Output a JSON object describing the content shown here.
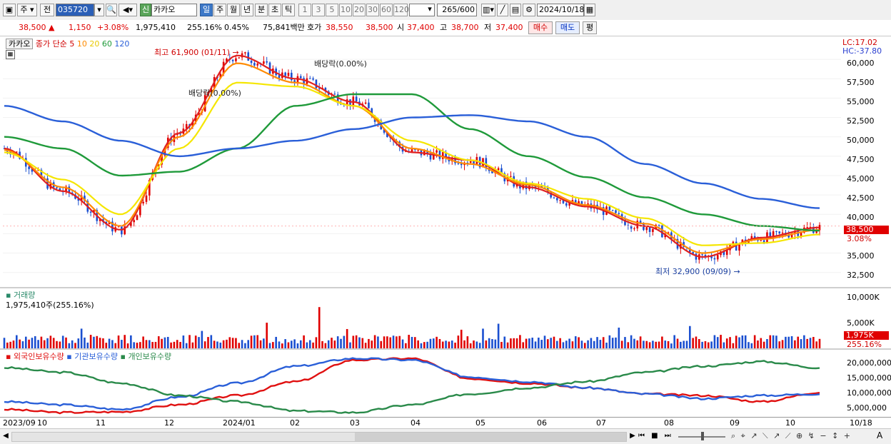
{
  "toolbar": {
    "period_label": "주",
    "prev_label": "전",
    "code": "035720",
    "market_badge": "신",
    "stock_name": "카카오",
    "interval_buttons": [
      "일",
      "주",
      "월",
      "년",
      "분",
      "초",
      "틱"
    ],
    "minute_buttons": [
      "1",
      "3",
      "5",
      "10",
      "20",
      "30",
      "60",
      "120"
    ],
    "count_value": "265",
    "count_total": "/600",
    "date_value": "2024/10/18"
  },
  "quote": {
    "price": "38,500",
    "arrow": "▲",
    "change": "1,150",
    "change_pct": "+3.08%",
    "volume": "1,975,410",
    "volume_pct": "255.16%",
    "turnover_pct": "0.45%",
    "amount": "75,841백만",
    "ask_label": "호가",
    "ask1": "38,550",
    "ask2": "38,500",
    "open_label": "시",
    "open": "37,400",
    "high_label": "고",
    "high": "38,700",
    "low_label": "저",
    "low": "37,400",
    "buy_label": "매수",
    "sell_label": "매도",
    "eval_label": "평"
  },
  "price_panel": {
    "stock_tab": "카카오",
    "legend_main": "종가 단순",
    "ma_5": "5",
    "ma_10": "10",
    "ma_20": "20",
    "ma_60": "60",
    "ma_120": "120",
    "lc": "LC:17.02",
    "hc": "HC:-37.80",
    "high_note": "최고 61,900 (01/11)",
    "low_note": "최저 32,900 (09/09)",
    "dividend_1": "배당락(0.00%)",
    "dividend_2": "배당락(0.00%)",
    "current_tag": "38,500",
    "current_pct": "3.08%",
    "y_ticks": [
      "60,000",
      "57,500",
      "55,000",
      "52,500",
      "50,000",
      "47,500",
      "45,000",
      "42,500",
      "40,000",
      "37,500",
      "35,000",
      "32,500"
    ],
    "colors": {
      "ma5": "#e02020",
      "ma10": "#ff8a00",
      "ma20": "#f5e600",
      "ma60": "#1f9a3a",
      "ma120": "#2a5fd8",
      "up": "#e00000",
      "down": "#1a4fd0"
    }
  },
  "volume_panel": {
    "title": "거래량",
    "value": "1,975,410주(255.16%)",
    "y_ticks": [
      "10,000K",
      "5,000K"
    ],
    "current_tag": "1,975K",
    "current_pct": "255.16%"
  },
  "holding_panel": {
    "foreign": "외국인보유수량",
    "institution": "기관보유수량",
    "individual": "개인보유수량",
    "y_ticks": [
      "20,000,000",
      "15,000,000",
      "10,000,000",
      "5,000,000"
    ],
    "colors": {
      "foreign": "#e01010",
      "institution": "#2a5fd8",
      "individual": "#2a8a4a"
    }
  },
  "dates": [
    "2023/09",
    "10",
    "11",
    "12",
    "2024/01",
    "02",
    "03",
    "04",
    "05",
    "06",
    "07",
    "08",
    "09",
    "10",
    "10/18"
  ],
  "chart_data": {
    "type": "line",
    "title": "",
    "ylim": [
      31000,
      62500
    ],
    "x": [
      "2023/09",
      "10",
      "11",
      "12",
      "2024/01",
      "02",
      "03",
      "04",
      "05",
      "06",
      "07",
      "08",
      "09",
      "10",
      "10/18"
    ],
    "series": [
      {
        "name": "5",
        "values": [
          48500,
          43000,
          38000,
          50500,
          60500,
          57500,
          54500,
          48000,
          47000,
          43500,
          41000,
          38500,
          34500,
          37000,
          38300
        ]
      },
      {
        "name": "10",
        "values": [
          48300,
          43500,
          38500,
          50000,
          59500,
          57000,
          54000,
          48500,
          46500,
          43800,
          41200,
          38800,
          35000,
          36800,
          38000
        ]
      },
      {
        "name": "20",
        "values": [
          48000,
          44500,
          40000,
          48500,
          57000,
          56500,
          54000,
          49500,
          47000,
          44000,
          42000,
          39500,
          36000,
          36300,
          37400
        ]
      },
      {
        "name": "60",
        "values": [
          50000,
          48500,
          45000,
          45500,
          48500,
          54000,
          55500,
          55500,
          51000,
          47500,
          44800,
          42200,
          40000,
          38500,
          37900
        ]
      },
      {
        "name": "120",
        "values": [
          54000,
          52000,
          49500,
          47500,
          48500,
          49500,
          51000,
          52500,
          52800,
          52000,
          50000,
          46500,
          44000,
          42000,
          40800
        ]
      }
    ]
  }
}
